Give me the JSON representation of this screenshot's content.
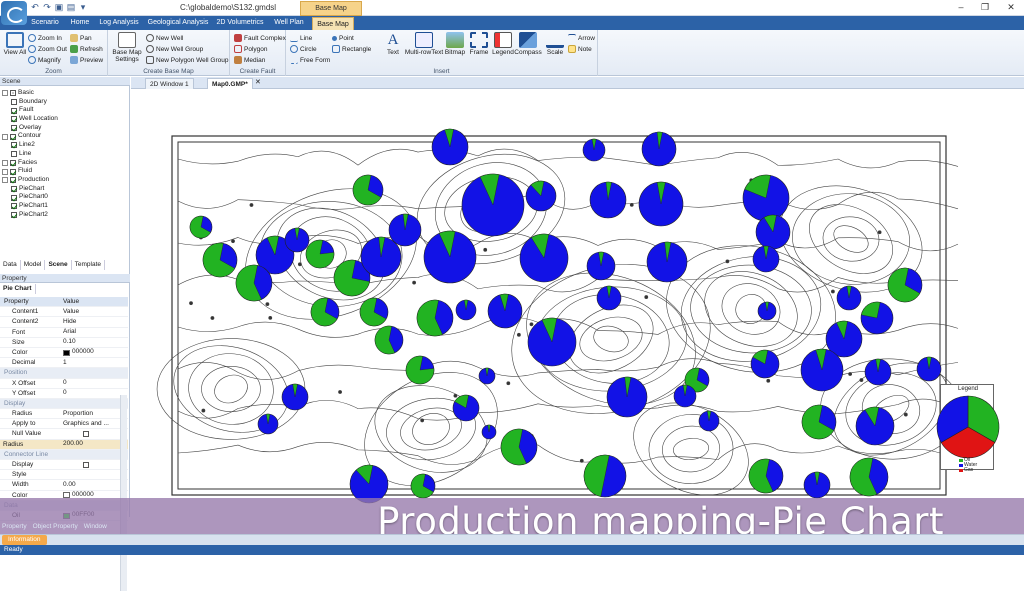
{
  "window": {
    "title": "C:\\globaldemo\\S132.gmdsl",
    "context_tab": "Base Map"
  },
  "tabs": [
    "Scenario",
    "Home",
    "Log Analysis",
    "Geological Analysis",
    "2D Volumetrics",
    "Well Plan",
    "Base Map"
  ],
  "ribbon": {
    "zoom": {
      "label": "Zoom",
      "view_all": "View All",
      "zoom_in": "Zoom In",
      "zoom_out": "Zoom Out",
      "magnify": "Magnify",
      "pan": "Pan",
      "refresh": "Refresh",
      "preview": "Preview"
    },
    "create_base_map": {
      "label": "Create Base Map",
      "settings": "Base Map Settings",
      "new_well": "New Well",
      "new_well_group": "New Well Group",
      "new_polygon_well_group": "New Polygon Well Group"
    },
    "create_fault": {
      "label": "Create Fault",
      "fault_complex": "Fault Complex",
      "polygon": "Polygon",
      "median": "Median"
    },
    "insert": {
      "label": "Insert",
      "line": "Line",
      "point": "Point",
      "circle": "Circle",
      "rectangle": "Rectangle",
      "free_form": "Free Form",
      "text": "Text",
      "multirow_text": "Multi-rowText",
      "bitmap": "Bitmap",
      "frame": "Frame",
      "legend": "Legend",
      "compass": "Compass",
      "scale": "Scale",
      "arrow": "Arrow",
      "note": "Note"
    }
  },
  "scene": {
    "header": "Scene",
    "tree": [
      {
        "label": "Basic",
        "level": 0,
        "check": "square"
      },
      {
        "label": "Boundary",
        "level": 1,
        "check": false
      },
      {
        "label": "Fault",
        "level": 1,
        "check": true
      },
      {
        "label": "Well Location",
        "level": 1,
        "check": true
      },
      {
        "label": "Overlay",
        "level": 1,
        "check": true
      },
      {
        "label": "Contour",
        "level": 0,
        "check": true
      },
      {
        "label": "Line2",
        "level": 1,
        "check": true
      },
      {
        "label": "Line",
        "level": 1,
        "check": false
      },
      {
        "label": "Facies",
        "level": 0,
        "check": true
      },
      {
        "label": "Fluid",
        "level": 0,
        "check": true
      },
      {
        "label": "Production",
        "level": 0,
        "check": true
      },
      {
        "label": "PieChart",
        "level": 1,
        "check": true
      },
      {
        "label": "PieChart0",
        "level": 1,
        "check": true
      },
      {
        "label": "PieChart1",
        "level": 1,
        "check": true
      },
      {
        "label": "PieChart2",
        "level": 1,
        "check": true
      }
    ]
  },
  "pane_tabs": [
    "Data",
    "Model",
    "Scene",
    "Template"
  ],
  "property": {
    "header": "Property",
    "subtab": "Pie Chart",
    "col_property": "Property",
    "col_value": "Value",
    "rows": [
      {
        "k": "Content1",
        "v": "Value"
      },
      {
        "k": "Content2",
        "v": "Hide"
      },
      {
        "k": "Font",
        "v": "Arial"
      },
      {
        "k": "Size",
        "v": "0.10"
      },
      {
        "k": "Color",
        "v": "000000",
        "swatch": "#000000"
      },
      {
        "k": "Decimal",
        "v": "1"
      },
      {
        "k": "Position",
        "cat": true
      },
      {
        "k": "X Offset",
        "v": "0"
      },
      {
        "k": "Y Offset",
        "v": "0"
      },
      {
        "k": "Display",
        "cat": true
      },
      {
        "k": "Radius",
        "v": "Proportion"
      },
      {
        "k": "Apply to",
        "v": "Graphics and ..."
      },
      {
        "k": "Null Value",
        "v": "",
        "check": true
      },
      {
        "k": "Radius",
        "v": "200.00",
        "hl": true
      },
      {
        "k": "Connector Line",
        "cat": true
      },
      {
        "k": "Display",
        "v": "",
        "check": true
      },
      {
        "k": "Style",
        "v": ""
      },
      {
        "k": "Width",
        "v": "0.00"
      },
      {
        "k": "Color",
        "v": "000000",
        "swatch": "#ffffff"
      },
      {
        "k": "Data",
        "cat": true
      },
      {
        "k": "Oil",
        "v": "00FF00",
        "swatch": "#00ff00"
      }
    ]
  },
  "bottom_tabs": [
    "Property",
    "Object Property",
    "Window"
  ],
  "info_tab": "Information",
  "status": "Ready",
  "doc_tabs": [
    "2D Window 1",
    "Map0.GMP*"
  ],
  "legend": {
    "title": "Legend",
    "keys": [
      "Oil",
      "Water",
      "Gas"
    ]
  },
  "colors": {
    "oil": "#22b322",
    "water": "#1212e6",
    "gas": "#e01414"
  },
  "banner": "Production mapping-Pie Chart",
  "pies": [
    [
      450,
      147,
      18,
      0.08
    ],
    [
      594,
      150,
      11,
      0
    ],
    [
      659,
      149,
      17,
      0.05
    ],
    [
      368,
      190,
      15,
      0.7
    ],
    [
      493,
      205,
      31,
      0.1
    ],
    [
      541,
      196,
      15,
      0.15
    ],
    [
      608,
      200,
      18,
      0.05
    ],
    [
      661,
      204,
      22,
      0.06
    ],
    [
      766,
      198,
      23,
      0.22
    ],
    [
      201,
      227,
      11,
      0.7
    ],
    [
      275,
      255,
      19,
      0.1
    ],
    [
      297,
      240,
      12,
      0
    ],
    [
      320,
      254,
      14,
      0.8
    ],
    [
      405,
      230,
      16,
      0.05
    ],
    [
      773,
      232,
      17,
      0.12
    ],
    [
      220,
      260,
      17,
      0.7
    ],
    [
      254,
      283,
      18,
      0.6
    ],
    [
      352,
      278,
      18,
      0.75
    ],
    [
      381,
      257,
      20,
      0.05
    ],
    [
      450,
      257,
      26,
      0.1
    ],
    [
      544,
      258,
      24,
      0.12
    ],
    [
      601,
      266,
      14,
      0
    ],
    [
      667,
      262,
      20,
      0.05
    ],
    [
      766,
      259,
      13,
      0
    ],
    [
      905,
      285,
      17,
      0.7
    ],
    [
      849,
      298,
      12,
      0
    ],
    [
      609,
      298,
      12,
      0
    ],
    [
      767,
      311,
      9,
      0
    ],
    [
      325,
      312,
      14,
      0.7
    ],
    [
      374,
      312,
      14,
      0.7
    ],
    [
      435,
      318,
      18,
      0.6
    ],
    [
      466,
      310,
      10,
      0
    ],
    [
      505,
      311,
      17,
      0.08
    ],
    [
      877,
      318,
      16,
      0.25
    ],
    [
      389,
      340,
      14,
      0.6
    ],
    [
      552,
      342,
      24,
      0.1
    ],
    [
      844,
      339,
      18,
      0.1
    ],
    [
      420,
      370,
      14,
      0.8
    ],
    [
      487,
      376,
      8,
      0
    ],
    [
      765,
      364,
      14,
      0.2
    ],
    [
      822,
      370,
      21,
      0.08
    ],
    [
      878,
      372,
      13,
      0
    ],
    [
      929,
      369,
      12,
      0
    ],
    [
      295,
      397,
      13,
      0
    ],
    [
      627,
      397,
      20,
      0.05
    ],
    [
      697,
      380,
      12,
      0.7
    ],
    [
      685,
      396,
      11,
      0
    ],
    [
      466,
      408,
      13,
      0.2
    ],
    [
      709,
      421,
      10,
      0
    ],
    [
      268,
      424,
      10,
      0
    ],
    [
      489,
      432,
      7,
      0
    ],
    [
      519,
      447,
      18,
      0.6
    ],
    [
      819,
      422,
      17,
      0.7
    ],
    [
      875,
      426,
      19,
      0.12
    ],
    [
      369,
      484,
      19,
      0.15
    ],
    [
      423,
      486,
      12,
      0.7
    ],
    [
      605,
      476,
      21,
      0.5
    ],
    [
      766,
      476,
      17,
      0.6
    ],
    [
      817,
      485,
      13,
      0
    ],
    [
      869,
      477,
      19,
      0.6
    ]
  ]
}
